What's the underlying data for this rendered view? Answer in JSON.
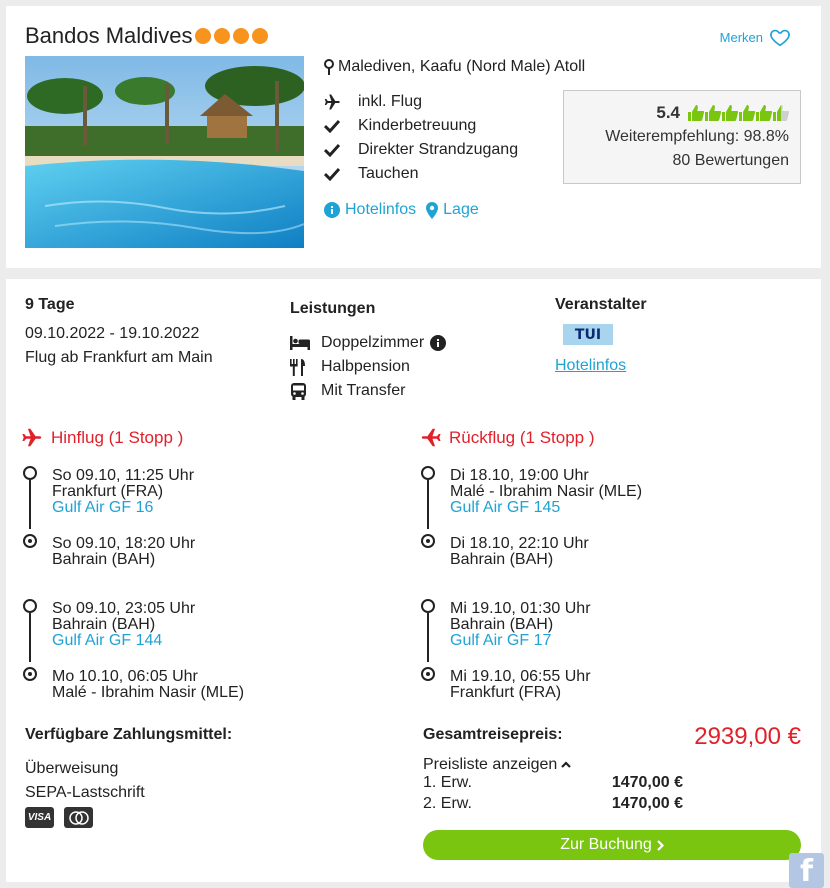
{
  "hotel": {
    "name": "Bandos Maldives",
    "stars": 4,
    "save_label": "Merken",
    "location": "Malediven, Kaafu (Nord Male) Atoll",
    "features": [
      {
        "icon": "plane-icon",
        "label": "inkl. Flug"
      },
      {
        "icon": "check-icon",
        "label": "Kinderbetreuung"
      },
      {
        "icon": "check-icon",
        "label": "Direkter Strandzugang"
      },
      {
        "icon": "check-icon",
        "label": "Tauchen"
      }
    ],
    "rating": {
      "score": "5.4",
      "thumbs_filled": 5.5,
      "thumbs_total": 6,
      "recommendation": "Weiterempfehlung: 98.8%",
      "reviews": "80 Bewertungen"
    },
    "links": {
      "hotelinfos": "Hotelinfos",
      "lage": "Lage"
    }
  },
  "offer": {
    "duration": "9 Tage",
    "dates": "09.10.2022 - 19.10.2022",
    "departure": "Flug ab Frankfurt am Main",
    "services_title": "Leistungen",
    "services": [
      {
        "icon": "bed-icon",
        "label": "Doppelzimmer"
      },
      {
        "icon": "cutlery-icon",
        "label": "Halbpension"
      },
      {
        "icon": "bus-icon",
        "label": "Mit Transfer"
      }
    ],
    "operator_title": "Veranstalter",
    "operator_logo": "TUI",
    "operator_link": "Hotelinfos"
  },
  "outbound": {
    "title": "Hinflug (1 Stopp )",
    "legs": [
      {
        "dep_time": "So 09.10, 11:25 Uhr",
        "dep_airport": "Frankfurt (FRA)",
        "airline": "Gulf Air GF 16",
        "arr_time": "So 09.10, 18:20 Uhr",
        "arr_airport": "Bahrain (BAH)"
      },
      {
        "dep_time": "So 09.10, 23:05 Uhr",
        "dep_airport": "Bahrain (BAH)",
        "airline": "Gulf Air GF 144",
        "arr_time": "Mo 10.10, 06:05 Uhr",
        "arr_airport": "Malé - Ibrahim Nasir (MLE)"
      }
    ]
  },
  "return": {
    "title": "Rückflug (1 Stopp )",
    "legs": [
      {
        "dep_time": "Di 18.10, 19:00 Uhr",
        "dep_airport": "Malé - Ibrahim Nasir (MLE)",
        "airline": "Gulf Air GF 145",
        "arr_time": "Di 18.10, 22:10 Uhr",
        "arr_airport": "Bahrain (BAH)"
      },
      {
        "dep_time": "Mi 19.10, 01:30 Uhr",
        "dep_airport": "Bahrain (BAH)",
        "airline": "Gulf Air GF 17",
        "arr_time": "Mi 19.10, 06:55 Uhr",
        "arr_airport": "Frankfurt (FRA)"
      }
    ]
  },
  "payment": {
    "title": "Verfügbare Zahlungsmittel:",
    "methods": [
      "Überweisung",
      "SEPA-Lastschrift"
    ],
    "cards": [
      {
        "icon": "visa-icon",
        "label": "VISA"
      },
      {
        "icon": "mastercard-icon",
        "label": ""
      }
    ]
  },
  "price": {
    "label": "Gesamtreisepreis:",
    "total": "2939,00 €",
    "list_toggle": "Preisliste anzeigen",
    "rows": [
      {
        "label": "1. Erw.",
        "amount": "1470,00 €"
      },
      {
        "label": "2. Erw.",
        "amount": "1470,00 €"
      }
    ],
    "book_label": "Zur Buchung"
  },
  "social": {
    "facebook_label": "f"
  },
  "colors": {
    "accent_blue": "#1fa3d4",
    "price_red": "#e2202a",
    "star_orange": "#f7941d",
    "rating_green": "#7ac50f",
    "book_green": "#7ac50f"
  }
}
